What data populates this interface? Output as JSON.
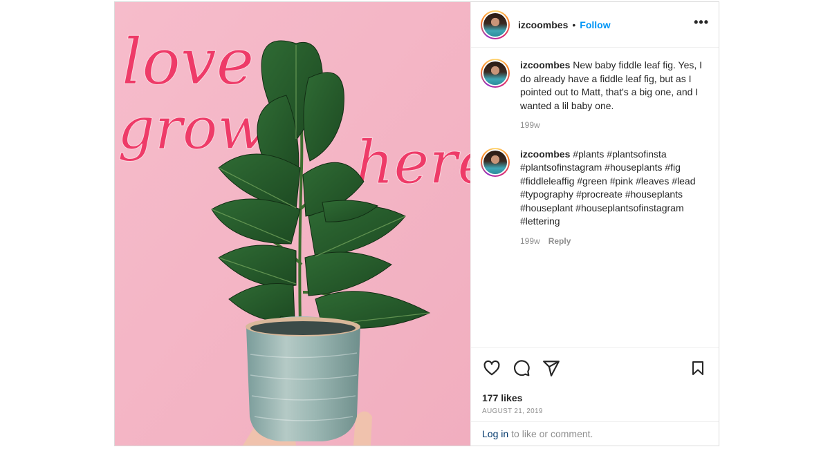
{
  "post": {
    "image": {
      "lettering": [
        "love",
        "grows",
        "here"
      ],
      "background_color": "#f5b6c6",
      "lettering_color": "#ee3b68"
    },
    "header": {
      "username": "izcoombes",
      "separator": "•",
      "follow_label": "Follow",
      "more_icon": "more-horizontal-icon"
    },
    "comments": [
      {
        "username": "izcoombes",
        "text": "New baby fiddle leaf fig. Yes, I do already have a fiddle leaf fig, but as I pointed out to Matt, that's a big one, and I wanted a lil baby one.",
        "age": "199w"
      },
      {
        "username": "izcoombes",
        "text": "#plants #plantsofinsta #plantsofinstagram #houseplants #fig #fiddleleaffig #green #pink #leaves #lead #typography #procreate #houseplants #houseplant #houseplantsofinstagram #lettering",
        "age": "199w",
        "reply_label": "Reply"
      }
    ],
    "actions": {
      "like_icon": "heart-icon",
      "comment_icon": "comment-icon",
      "share_icon": "send-icon",
      "save_icon": "bookmark-icon"
    },
    "likes": "177 likes",
    "date": "AUGUST 21, 2019",
    "login_prompt": {
      "link": "Log in",
      "text": "to like or comment."
    },
    "colors": {
      "accent": "#0095f6",
      "link_dark": "#00376b",
      "muted": "#8e8e8e"
    }
  }
}
